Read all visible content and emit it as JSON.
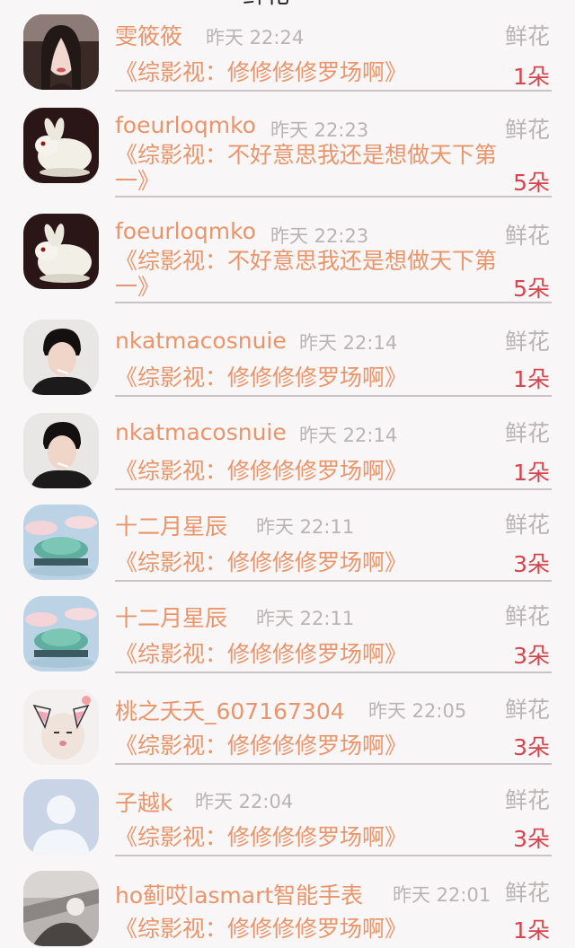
{
  "header": {
    "title": "鲜花"
  },
  "items": [
    {
      "name": "雯筱筱",
      "time": "昨天 22:24",
      "gift": "鲜花",
      "book": "《综影视：修修修修罗场啊》",
      "count": "1朵",
      "avatar": "girl-portrait-avatar"
    },
    {
      "name": "foeurloqmko",
      "time": "昨天 22:23",
      "gift": "鲜花",
      "book": "《综影视：不好意思我还是想做天下第一》",
      "count": "5朵",
      "avatar": "jade-rabbit-avatar"
    },
    {
      "name": "foeurloqmko",
      "time": "昨天 22:23",
      "gift": "鲜花",
      "book": "《综影视：不好意思我还是想做天下第一》",
      "count": "5朵",
      "avatar": "jade-rabbit-avatar"
    },
    {
      "name": "nkatmacosnuie",
      "time": "昨天 22:14",
      "gift": "鲜花",
      "book": "《综影视：修修修修罗场啊》",
      "count": "1朵",
      "avatar": "man-portrait-avatar"
    },
    {
      "name": "nkatmacosnuie",
      "time": "昨天 22:14",
      "gift": "鲜花",
      "book": "《综影视：修修修修罗场啊》",
      "count": "1朵",
      "avatar": "man-portrait-avatar"
    },
    {
      "name": "十二月星辰",
      "time": "昨天 22:11",
      "gift": "鲜花",
      "book": "《综影视：修修修修罗场啊》",
      "count": "3朵",
      "avatar": "landscape-island-avatar"
    },
    {
      "name": "十二月星辰",
      "time": "昨天 22:11",
      "gift": "鲜花",
      "book": "《综影视：修修修修罗场啊》",
      "count": "3朵",
      "avatar": "landscape-island-avatar"
    },
    {
      "name": "桃之夭夭_607167304",
      "time": "昨天 22:05",
      "gift": "鲜花",
      "book": "《综影视：修修修修罗场啊》",
      "count": "3朵",
      "avatar": "cat-baby-avatar"
    },
    {
      "name": "子越k",
      "time": "昨天 22:04",
      "gift": "鲜花",
      "book": "《综影视：修修修修罗场啊》",
      "count": "3朵",
      "avatar": "default-person-avatar"
    },
    {
      "name": "ho蓟哎lasmart智能手表",
      "time": "昨天 22:01",
      "gift": "鲜花",
      "book": "《综影视：修修修修罗场啊》",
      "count": "1朵",
      "avatar": "blurred-photo-avatar"
    }
  ]
}
